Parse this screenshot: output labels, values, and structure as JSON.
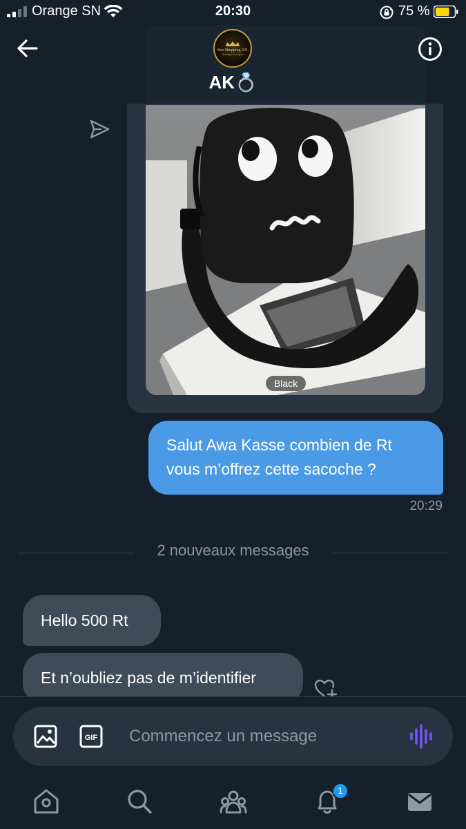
{
  "status_bar": {
    "carrier": "Orange SN",
    "time": "20:30",
    "battery_percent": "75 %",
    "battery_level": 0.75,
    "signal_bars_active": 2
  },
  "header": {
    "display_name": "AK💍",
    "avatar_text": "Sen Shopping 221",
    "avatar_subtext": "Boutique en ligne"
  },
  "conversation": {
    "media": {
      "alt_badge": "Black",
      "description_icon": "backpack-photo"
    },
    "sent_message": {
      "text": "Salut Awa Kasse combien de Rt vous m’offrez cette sacoche ?",
      "time": "20:29"
    },
    "divider": "2 nouveaux messages",
    "received_messages": [
      {
        "text": "Hello 500 Rt"
      },
      {
        "text": "Et n’oubliez pas de m’identifier"
      }
    ]
  },
  "composer": {
    "placeholder": "Commencez un message",
    "image_icon": "image-icon",
    "gif_label": "GIF"
  },
  "bottom_nav": {
    "items": [
      "home-icon",
      "search-icon",
      "communities-icon",
      "notifications-icon",
      "messages-icon"
    ],
    "notification_count": "1"
  },
  "colors": {
    "background": "#15202b",
    "sent_bubble": "#4a9ae6",
    "received_bubble": "#3e4c5a",
    "accent": "#1d9bf0",
    "voice_icon": "#7856ff"
  }
}
